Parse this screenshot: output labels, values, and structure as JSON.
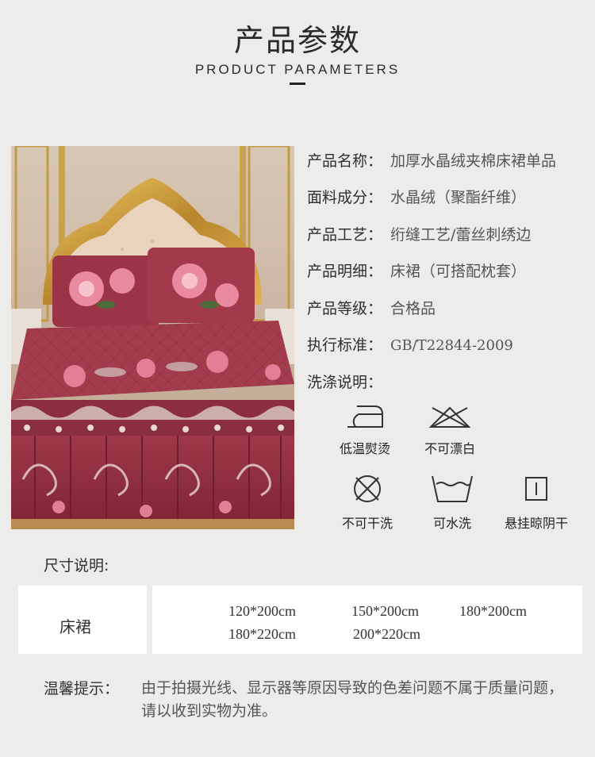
{
  "header": {
    "title_cn": "产品参数",
    "title_en": "PRODUCT PARAMETERS"
  },
  "photo": {
    "subject": "bed-skirt-photo"
  },
  "params": [
    {
      "label": "产品名称：",
      "value": "加厚水晶绒夹棉床裙单品"
    },
    {
      "label": "面料成分：",
      "value": "水晶绒（聚酯纤维）"
    },
    {
      "label": "产品工艺：",
      "value": "绗缝工艺/蕾丝刺绣边"
    },
    {
      "label": "产品明细：",
      "value": "床裙（可搭配枕套）"
    },
    {
      "label": "产品等级：",
      "value": "合格品"
    },
    {
      "label": "执行标准：",
      "value": "GB/T22844-2009"
    },
    {
      "label": "洗涤说明：",
      "value": ""
    }
  ],
  "care": [
    {
      "icon": "low-temp-iron-icon",
      "label": "低温熨烫"
    },
    {
      "icon": "no-bleach-icon",
      "label": "不可漂白"
    },
    {
      "icon": "no-dry-clean-icon",
      "label": "不可干洗"
    },
    {
      "icon": "hand-wash-icon",
      "label": "可水洗"
    },
    {
      "icon": "hang-dry-shade-icon",
      "label": "悬挂晾阴干"
    }
  ],
  "sizes": {
    "title": "尺寸说明:",
    "product": "床裙",
    "row1": [
      "120*200cm",
      "150*200cm",
      "180*200cm"
    ],
    "row2": [
      "180*220cm",
      "200*220cm"
    ]
  },
  "tip": {
    "label": "温馨提示：",
    "text": "由于拍摄光线、显示器等原因导致的色差问题不属于质量问题，请以收到实物为准。"
  }
}
